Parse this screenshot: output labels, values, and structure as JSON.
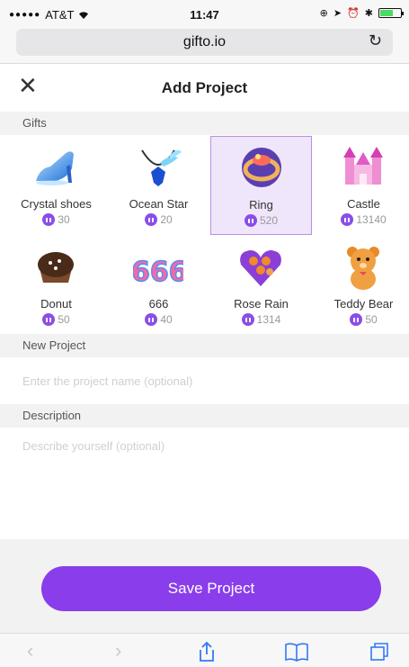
{
  "status": {
    "carrier": "AT&T",
    "time": "11:47"
  },
  "browser": {
    "url": "gifto.io"
  },
  "header": {
    "title": "Add Project"
  },
  "gifts_section": {
    "label": "Gifts"
  },
  "gifts": [
    {
      "name": "Crystal shoes",
      "price": "30"
    },
    {
      "name": "Ocean Star",
      "price": "20"
    },
    {
      "name": "Ring",
      "price": "520",
      "selected": true
    },
    {
      "name": "Castle",
      "price": "13140"
    },
    {
      "name": "Donut",
      "price": "50"
    },
    {
      "name": "666",
      "price": "40"
    },
    {
      "name": "Rose Rain",
      "price": "1314"
    },
    {
      "name": "Teddy Bear",
      "price": "50"
    }
  ],
  "project": {
    "label": "New Project",
    "placeholder": "Enter the project name (optional)"
  },
  "description": {
    "label": "Description",
    "placeholder": "Describe yourself (optional)"
  },
  "actions": {
    "save_label": "Save Project"
  },
  "colors": {
    "accent": "#8a3dea",
    "selected_bg": "#f0e6fb"
  }
}
